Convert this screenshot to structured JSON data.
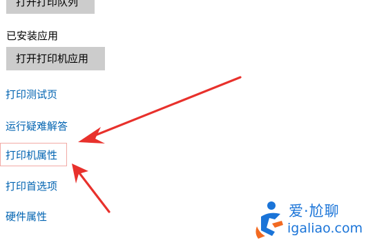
{
  "settings": {
    "open_queue_button": "打开打印队列",
    "installed_app_label": "已安装应用",
    "open_printer_app_button": "打开打印机应用",
    "links": {
      "print_test_page": "打印测试页",
      "run_troubleshooter": "运行疑难解答",
      "printer_properties": "打印机属性",
      "printing_preferences": "打印首选项",
      "hardware_properties": "硬件属性"
    }
  },
  "annotations": {
    "arrow_color": "#e8312c",
    "highlight_color": "#f2a9a4"
  },
  "watermark": {
    "brand": "爱·尬聊",
    "url": "igaliao.com",
    "color": "#1a74d8",
    "logo_accent": "#f26a21"
  }
}
